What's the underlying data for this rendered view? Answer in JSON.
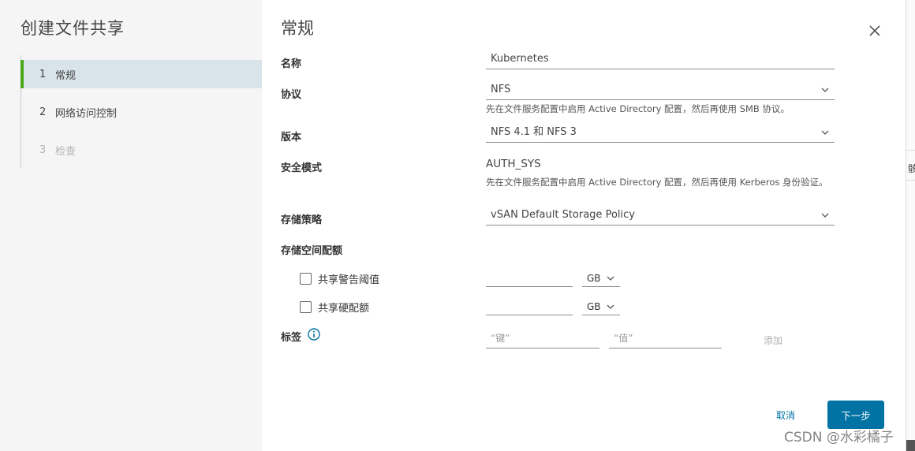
{
  "nav": {
    "title": "创建文件共享",
    "steps": [
      {
        "num": "1",
        "label": "常规"
      },
      {
        "num": "2",
        "label": "网络访问控制"
      },
      {
        "num": "3",
        "label": "检查"
      }
    ]
  },
  "main": {
    "section_title": "常规",
    "name": {
      "label": "名称",
      "value": "Kubernetes"
    },
    "protocol": {
      "label": "协议",
      "value": "NFS",
      "hint": "先在文件服务配置中启用 Active Directory 配置，然后再使用 SMB 协议。"
    },
    "version": {
      "label": "版本",
      "value": "NFS 4.1 和 NFS 3"
    },
    "security": {
      "label": "安全模式",
      "value": "AUTH_SYS",
      "hint": "先在文件服务配置中启用 Active Directory 配置，然后再使用 Kerberos 身份验证。"
    },
    "storage_policy": {
      "label": "存储策略",
      "value": "vSAN Default Storage Policy"
    },
    "quota": {
      "label": "存储空间配额",
      "warning": {
        "label": "共享警告阈值",
        "unit": "GB"
      },
      "hard": {
        "label": "共享硬配额",
        "unit": "GB"
      }
    },
    "tags": {
      "label": "标签",
      "key_placeholder": "“键”",
      "value_placeholder": "“值”",
      "add_label": "添加"
    }
  },
  "footer": {
    "cancel_label": "取消",
    "next_label": "下一步"
  },
  "watermark": "CSDN @水彩橘子",
  "edge_glyph": "骸",
  "colors": {
    "accent": "#0072a3",
    "active_step_bg": "#d8e3ea",
    "active_step_bar": "#49a81e"
  }
}
